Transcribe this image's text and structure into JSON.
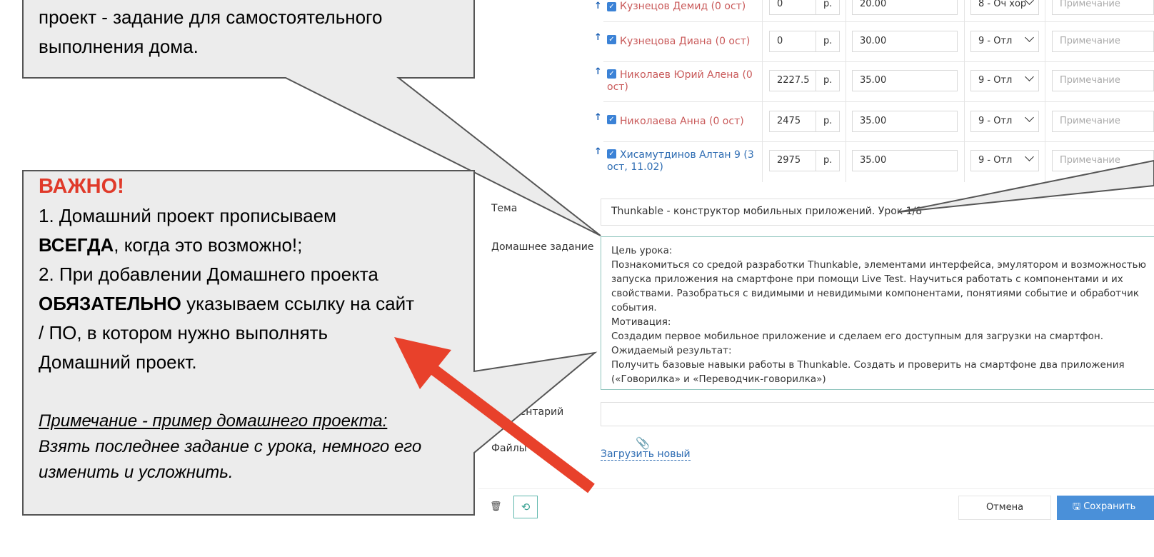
{
  "callout_top": {
    "lines": [
      "проект - задание для самостоятельного",
      "выполнения дома."
    ]
  },
  "callout_main": {
    "important": "ВАЖНО!",
    "point1_a": "1. Домашний проект прописываем",
    "point1_bold": "ВСЕГДА",
    "point1_b": ", когда это возможно!;",
    "point2_a": "2. При добавлении Домашнего проекта",
    "point2_bold": "ОБЯЗАТЕЛЬНО",
    "point2_b": " указываем ссылку на сайт",
    "point2_c": "/ ПО, в котором нужно выполнять",
    "point2_d": "Домашний проект.",
    "note_title": "Примечание - пример домашнего проекта:",
    "note_line1": "Взять последнее задание с урока, немного его",
    "note_line2": "изменить и усложнить."
  },
  "students": [
    {
      "name": "Кузнецов Демид (0 ост)",
      "amount": "0",
      "currency": "р.",
      "grade_value": "20.00",
      "grade": "8 - Оч хор",
      "note_placeholder": "Примечание",
      "color": "red"
    },
    {
      "name": "Кузнецова Диана (0 ост)",
      "amount": "0",
      "currency": "р.",
      "grade_value": "30.00",
      "grade": "9 - Отл",
      "note_placeholder": "Примечание",
      "color": "red"
    },
    {
      "name": "Николаев Юрий Алена (0 ост)",
      "amount": "2227.5",
      "currency": "р.",
      "grade_value": "35.00",
      "grade": "9 - Отл",
      "note_placeholder": "Примечание",
      "color": "red"
    },
    {
      "name": "Николаева Анна (0 ост)",
      "amount": "2475",
      "currency": "р.",
      "grade_value": "35.00",
      "grade": "9 - Отл",
      "note_placeholder": "Примечание",
      "color": "red"
    },
    {
      "name": "Хисамутдинов Алтан 9 (3 ост, 11.02)",
      "amount": "2975",
      "currency": "р.",
      "grade_value": "35.00",
      "grade": "9 - Отл",
      "note_placeholder": "Примечание",
      "color": "blue"
    }
  ],
  "form": {
    "topic_label": "Тема",
    "topic_value": "Thunkable - конструктор мобильных приложений. Урок 1/8",
    "homework_label": "Домашнее задание",
    "homework_lines": [
      "Цель урока:",
      "Познакомиться со средой разработки Thunkable, элементами интерфейса, эмулятором и возможностью",
      "запуска приложения на смартфоне при помощи Live Test. Научиться работать с компонентами и их",
      "свойствами. Разобраться с видимыми и невидимыми компонентами, понятиями событие и обработчик",
      "события.",
      "Мотивация:",
      "Создадим первое мобильное  приложение и сделаем его доступным для загрузки на смартфон.",
      "Ожидаемый результат:",
      "Получить базовые навыки работы в Thunkable. Создать и проверить на смартфоне два приложения",
      "(«Говорилка» и «Переводчик-говорилка»)"
    ],
    "comment_label": "Комментарий",
    "files_label": "Файлы",
    "upload_link": "Загрузить новый"
  },
  "footer": {
    "cancel": "Отмена",
    "save": "Сохранить"
  },
  "colors": {
    "callout_bg": "#ececec",
    "important_red": "#e03a2a",
    "arrow_red": "#e8412b",
    "link_blue": "#2f6db3",
    "save_blue": "#4a90d9"
  }
}
